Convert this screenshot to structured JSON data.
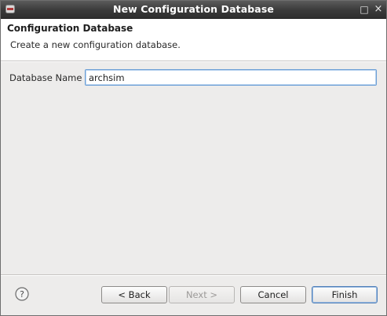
{
  "window": {
    "title": "New Configuration Database",
    "maximize_icon": "□",
    "close_icon": "×"
  },
  "header": {
    "title": "Configuration Database",
    "description": "Create a new configuration database."
  },
  "form": {
    "database_name_label": "Database Name :",
    "database_name_value": "archsim"
  },
  "buttons": {
    "back": "< Back",
    "next": "Next >",
    "cancel": "Cancel",
    "finish": "Finish"
  },
  "icons": {
    "app": "app-icon",
    "help": "help-icon",
    "help_glyph": "?"
  }
}
